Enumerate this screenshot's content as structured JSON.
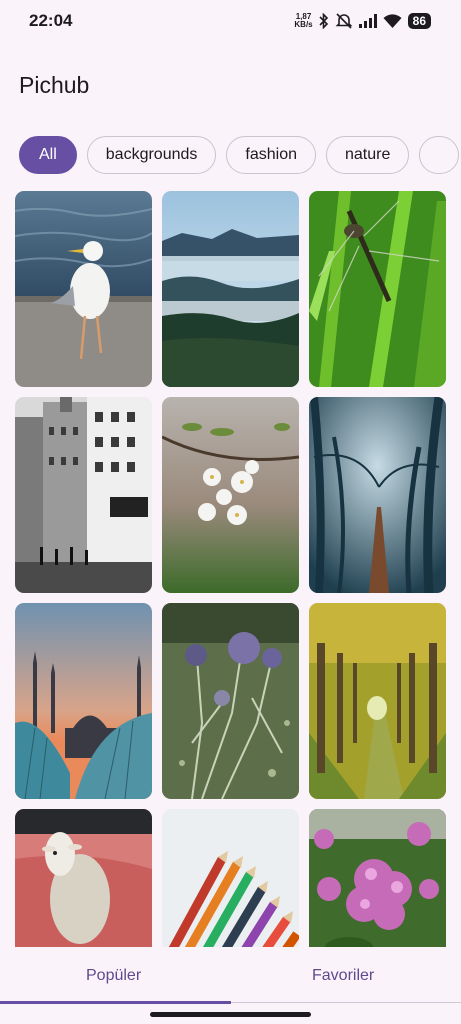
{
  "status_bar": {
    "time": "22:04",
    "net_speed_value": "1,87",
    "net_speed_unit": "KB/s",
    "battery": "86",
    "icons": [
      "bluetooth-icon",
      "mute-icon",
      "signal-icon",
      "wifi-icon",
      "battery-icon"
    ]
  },
  "app": {
    "title": "Pichub"
  },
  "filters": {
    "chips": [
      "All",
      "backgrounds",
      "fashion",
      "nature"
    ],
    "selected": "All"
  },
  "photos": [
    "seagull-on-pier",
    "misty-forest-valley",
    "dragonfly-on-grass",
    "city-street-black-white",
    "white-blossom-branch",
    "foggy-forest-path",
    "mosque-at-sunset",
    "thistle-flowers",
    "tree-tunnel-path",
    "sheep-on-roof",
    "colored-pencils",
    "pink-rhododendron"
  ],
  "bottom_nav": {
    "tabs": [
      "Popüler",
      "Favoriler"
    ],
    "selected_index": 0
  },
  "colors": {
    "accent": "#6750a4",
    "background": "#fbf3fa",
    "chip_border": "#cac4cf"
  }
}
